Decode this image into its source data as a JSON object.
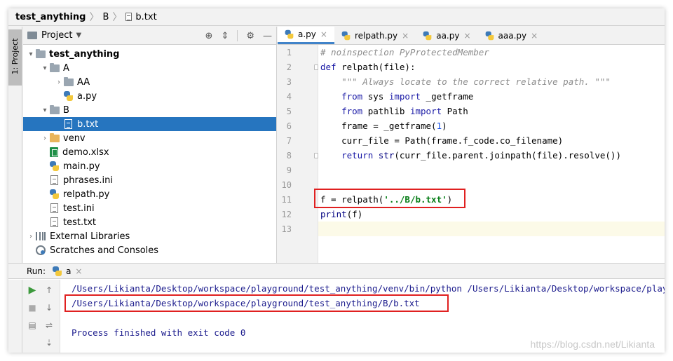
{
  "breadcrumb": [
    "test_anything",
    "B",
    "b.txt"
  ],
  "sidebar_tab": "1: Project",
  "project_panel": {
    "title": "Project",
    "tree": [
      {
        "label": "test_anything",
        "indent": 0,
        "arrow": "▾",
        "icon": "folder",
        "bold": true
      },
      {
        "label": "A",
        "indent": 1,
        "arrow": "▾",
        "icon": "folder"
      },
      {
        "label": "AA",
        "indent": 2,
        "arrow": "›",
        "icon": "folder"
      },
      {
        "label": "a.py",
        "indent": 2,
        "arrow": "",
        "icon": "py"
      },
      {
        "label": "B",
        "indent": 1,
        "arrow": "▾",
        "icon": "folder"
      },
      {
        "label": "b.txt",
        "indent": 2,
        "arrow": "",
        "icon": "file",
        "selected": true
      },
      {
        "label": "venv",
        "indent": 1,
        "arrow": "›",
        "icon": "folder-orange"
      },
      {
        "label": "demo.xlsx",
        "indent": 1,
        "arrow": "",
        "icon": "xlsx"
      },
      {
        "label": "main.py",
        "indent": 1,
        "arrow": "",
        "icon": "py"
      },
      {
        "label": "phrases.ini",
        "indent": 1,
        "arrow": "",
        "icon": "file"
      },
      {
        "label": "relpath.py",
        "indent": 1,
        "arrow": "",
        "icon": "py"
      },
      {
        "label": "test.ini",
        "indent": 1,
        "arrow": "",
        "icon": "file"
      },
      {
        "label": "test.txt",
        "indent": 1,
        "arrow": "",
        "icon": "file"
      },
      {
        "label": "External Libraries",
        "indent": 0,
        "arrow": "›",
        "icon": "lib"
      },
      {
        "label": "Scratches and Consoles",
        "indent": 0,
        "arrow": "",
        "icon": "scratch"
      }
    ]
  },
  "editor_tabs": [
    {
      "label": "a.py",
      "active": true
    },
    {
      "label": "relpath.py",
      "active": false
    },
    {
      "label": "aa.py",
      "active": false
    },
    {
      "label": "aaa.py",
      "active": false
    }
  ],
  "code_lines": [
    [
      {
        "t": "# noinspection PyProtectedMember",
        "c": "cm"
      }
    ],
    [
      {
        "t": "def ",
        "c": "kw"
      },
      {
        "t": "relpath(file):",
        "c": ""
      }
    ],
    [
      {
        "t": "    ",
        "c": ""
      },
      {
        "t": "\"\"\" Always locate to the correct relative path. \"\"\"",
        "c": "cm"
      }
    ],
    [
      {
        "t": "    ",
        "c": ""
      },
      {
        "t": "from ",
        "c": "kw"
      },
      {
        "t": "sys ",
        "c": ""
      },
      {
        "t": "import ",
        "c": "kw"
      },
      {
        "t": "_getframe",
        "c": ""
      }
    ],
    [
      {
        "t": "    ",
        "c": ""
      },
      {
        "t": "from ",
        "c": "kw"
      },
      {
        "t": "pathlib ",
        "c": ""
      },
      {
        "t": "import ",
        "c": "kw"
      },
      {
        "t": "Path",
        "c": ""
      }
    ],
    [
      {
        "t": "    frame = _getframe(",
        "c": ""
      },
      {
        "t": "1",
        "c": "num"
      },
      {
        "t": ")",
        "c": ""
      }
    ],
    [
      {
        "t": "    curr_file = Path(frame.f_code.co_filename)",
        "c": ""
      }
    ],
    [
      {
        "t": "    ",
        "c": ""
      },
      {
        "t": "return ",
        "c": "kw"
      },
      {
        "t": "str",
        "c": "fn"
      },
      {
        "t": "(curr_file.parent.joinpath(file).resolve())",
        "c": ""
      }
    ],
    [],
    [],
    [
      {
        "t": "f = relpath(",
        "c": ""
      },
      {
        "t": "'../B/b.txt'",
        "c": "str"
      },
      {
        "t": ")",
        "c": ""
      }
    ],
    [
      {
        "t": "print",
        "c": "fn"
      },
      {
        "t": "(f)",
        "c": ""
      }
    ],
    []
  ],
  "line_numbers": [
    "1",
    "2",
    "3",
    "4",
    "5",
    "6",
    "7",
    "8",
    "9",
    "10",
    "11",
    "12",
    "13"
  ],
  "run_panel": {
    "label": "Run:",
    "config": "a",
    "output": [
      "/Users/Likianta/Desktop/workspace/playground/test_anything/venv/bin/python /Users/Likianta/Desktop/workspace/playground/test_anything/A/a.py",
      "/Users/Likianta/Desktop/workspace/playground/test_anything/B/b.txt",
      "",
      "Process finished with exit code 0"
    ]
  },
  "watermark": "https://blog.csdn.net/Likianta",
  "colors": {
    "selection": "#2675bf",
    "highlight_box": "#e02020",
    "keyword": "#1a1aa6",
    "string": "#067d17"
  }
}
